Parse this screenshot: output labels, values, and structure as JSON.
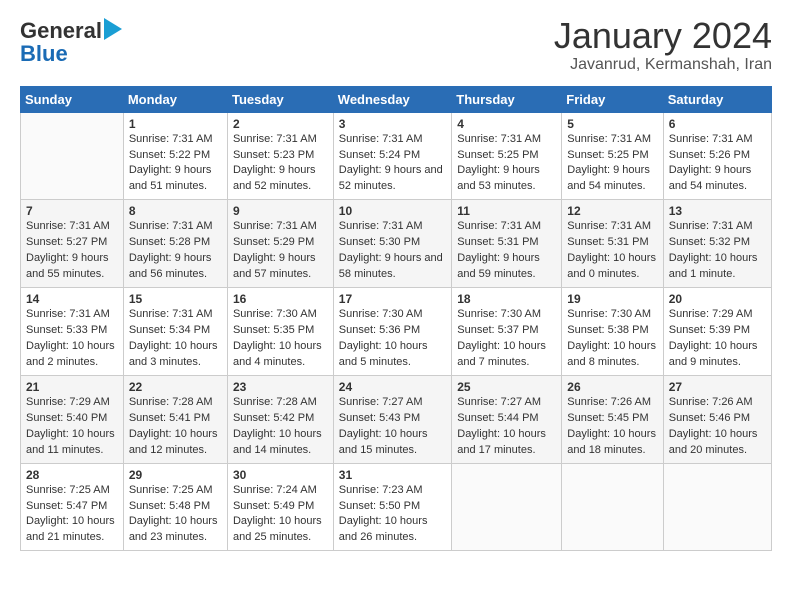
{
  "header": {
    "logo_general": "General",
    "logo_blue": "Blue",
    "month": "January 2024",
    "location": "Javanrud, Kermanshah, Iran"
  },
  "columns": [
    "Sunday",
    "Monday",
    "Tuesday",
    "Wednesday",
    "Thursday",
    "Friday",
    "Saturday"
  ],
  "weeks": [
    [
      {
        "day": "",
        "sunrise": "",
        "sunset": "",
        "daylight": ""
      },
      {
        "day": "1",
        "sunrise": "Sunrise: 7:31 AM",
        "sunset": "Sunset: 5:22 PM",
        "daylight": "Daylight: 9 hours and 51 minutes."
      },
      {
        "day": "2",
        "sunrise": "Sunrise: 7:31 AM",
        "sunset": "Sunset: 5:23 PM",
        "daylight": "Daylight: 9 hours and 52 minutes."
      },
      {
        "day": "3",
        "sunrise": "Sunrise: 7:31 AM",
        "sunset": "Sunset: 5:24 PM",
        "daylight": "Daylight: 9 hours and 52 minutes."
      },
      {
        "day": "4",
        "sunrise": "Sunrise: 7:31 AM",
        "sunset": "Sunset: 5:25 PM",
        "daylight": "Daylight: 9 hours and 53 minutes."
      },
      {
        "day": "5",
        "sunrise": "Sunrise: 7:31 AM",
        "sunset": "Sunset: 5:25 PM",
        "daylight": "Daylight: 9 hours and 54 minutes."
      },
      {
        "day": "6",
        "sunrise": "Sunrise: 7:31 AM",
        "sunset": "Sunset: 5:26 PM",
        "daylight": "Daylight: 9 hours and 54 minutes."
      }
    ],
    [
      {
        "day": "7",
        "sunrise": "Sunrise: 7:31 AM",
        "sunset": "Sunset: 5:27 PM",
        "daylight": "Daylight: 9 hours and 55 minutes."
      },
      {
        "day": "8",
        "sunrise": "Sunrise: 7:31 AM",
        "sunset": "Sunset: 5:28 PM",
        "daylight": "Daylight: 9 hours and 56 minutes."
      },
      {
        "day": "9",
        "sunrise": "Sunrise: 7:31 AM",
        "sunset": "Sunset: 5:29 PM",
        "daylight": "Daylight: 9 hours and 57 minutes."
      },
      {
        "day": "10",
        "sunrise": "Sunrise: 7:31 AM",
        "sunset": "Sunset: 5:30 PM",
        "daylight": "Daylight: 9 hours and 58 minutes."
      },
      {
        "day": "11",
        "sunrise": "Sunrise: 7:31 AM",
        "sunset": "Sunset: 5:31 PM",
        "daylight": "Daylight: 9 hours and 59 minutes."
      },
      {
        "day": "12",
        "sunrise": "Sunrise: 7:31 AM",
        "sunset": "Sunset: 5:31 PM",
        "daylight": "Daylight: 10 hours and 0 minutes."
      },
      {
        "day": "13",
        "sunrise": "Sunrise: 7:31 AM",
        "sunset": "Sunset: 5:32 PM",
        "daylight": "Daylight: 10 hours and 1 minute."
      }
    ],
    [
      {
        "day": "14",
        "sunrise": "Sunrise: 7:31 AM",
        "sunset": "Sunset: 5:33 PM",
        "daylight": "Daylight: 10 hours and 2 minutes."
      },
      {
        "day": "15",
        "sunrise": "Sunrise: 7:31 AM",
        "sunset": "Sunset: 5:34 PM",
        "daylight": "Daylight: 10 hours and 3 minutes."
      },
      {
        "day": "16",
        "sunrise": "Sunrise: 7:30 AM",
        "sunset": "Sunset: 5:35 PM",
        "daylight": "Daylight: 10 hours and 4 minutes."
      },
      {
        "day": "17",
        "sunrise": "Sunrise: 7:30 AM",
        "sunset": "Sunset: 5:36 PM",
        "daylight": "Daylight: 10 hours and 5 minutes."
      },
      {
        "day": "18",
        "sunrise": "Sunrise: 7:30 AM",
        "sunset": "Sunset: 5:37 PM",
        "daylight": "Daylight: 10 hours and 7 minutes."
      },
      {
        "day": "19",
        "sunrise": "Sunrise: 7:30 AM",
        "sunset": "Sunset: 5:38 PM",
        "daylight": "Daylight: 10 hours and 8 minutes."
      },
      {
        "day": "20",
        "sunrise": "Sunrise: 7:29 AM",
        "sunset": "Sunset: 5:39 PM",
        "daylight": "Daylight: 10 hours and 9 minutes."
      }
    ],
    [
      {
        "day": "21",
        "sunrise": "Sunrise: 7:29 AM",
        "sunset": "Sunset: 5:40 PM",
        "daylight": "Daylight: 10 hours and 11 minutes."
      },
      {
        "day": "22",
        "sunrise": "Sunrise: 7:28 AM",
        "sunset": "Sunset: 5:41 PM",
        "daylight": "Daylight: 10 hours and 12 minutes."
      },
      {
        "day": "23",
        "sunrise": "Sunrise: 7:28 AM",
        "sunset": "Sunset: 5:42 PM",
        "daylight": "Daylight: 10 hours and 14 minutes."
      },
      {
        "day": "24",
        "sunrise": "Sunrise: 7:27 AM",
        "sunset": "Sunset: 5:43 PM",
        "daylight": "Daylight: 10 hours and 15 minutes."
      },
      {
        "day": "25",
        "sunrise": "Sunrise: 7:27 AM",
        "sunset": "Sunset: 5:44 PM",
        "daylight": "Daylight: 10 hours and 17 minutes."
      },
      {
        "day": "26",
        "sunrise": "Sunrise: 7:26 AM",
        "sunset": "Sunset: 5:45 PM",
        "daylight": "Daylight: 10 hours and 18 minutes."
      },
      {
        "day": "27",
        "sunrise": "Sunrise: 7:26 AM",
        "sunset": "Sunset: 5:46 PM",
        "daylight": "Daylight: 10 hours and 20 minutes."
      }
    ],
    [
      {
        "day": "28",
        "sunrise": "Sunrise: 7:25 AM",
        "sunset": "Sunset: 5:47 PM",
        "daylight": "Daylight: 10 hours and 21 minutes."
      },
      {
        "day": "29",
        "sunrise": "Sunrise: 7:25 AM",
        "sunset": "Sunset: 5:48 PM",
        "daylight": "Daylight: 10 hours and 23 minutes."
      },
      {
        "day": "30",
        "sunrise": "Sunrise: 7:24 AM",
        "sunset": "Sunset: 5:49 PM",
        "daylight": "Daylight: 10 hours and 25 minutes."
      },
      {
        "day": "31",
        "sunrise": "Sunrise: 7:23 AM",
        "sunset": "Sunset: 5:50 PM",
        "daylight": "Daylight: 10 hours and 26 minutes."
      },
      {
        "day": "",
        "sunrise": "",
        "sunset": "",
        "daylight": ""
      },
      {
        "day": "",
        "sunrise": "",
        "sunset": "",
        "daylight": ""
      },
      {
        "day": "",
        "sunrise": "",
        "sunset": "",
        "daylight": ""
      }
    ]
  ]
}
